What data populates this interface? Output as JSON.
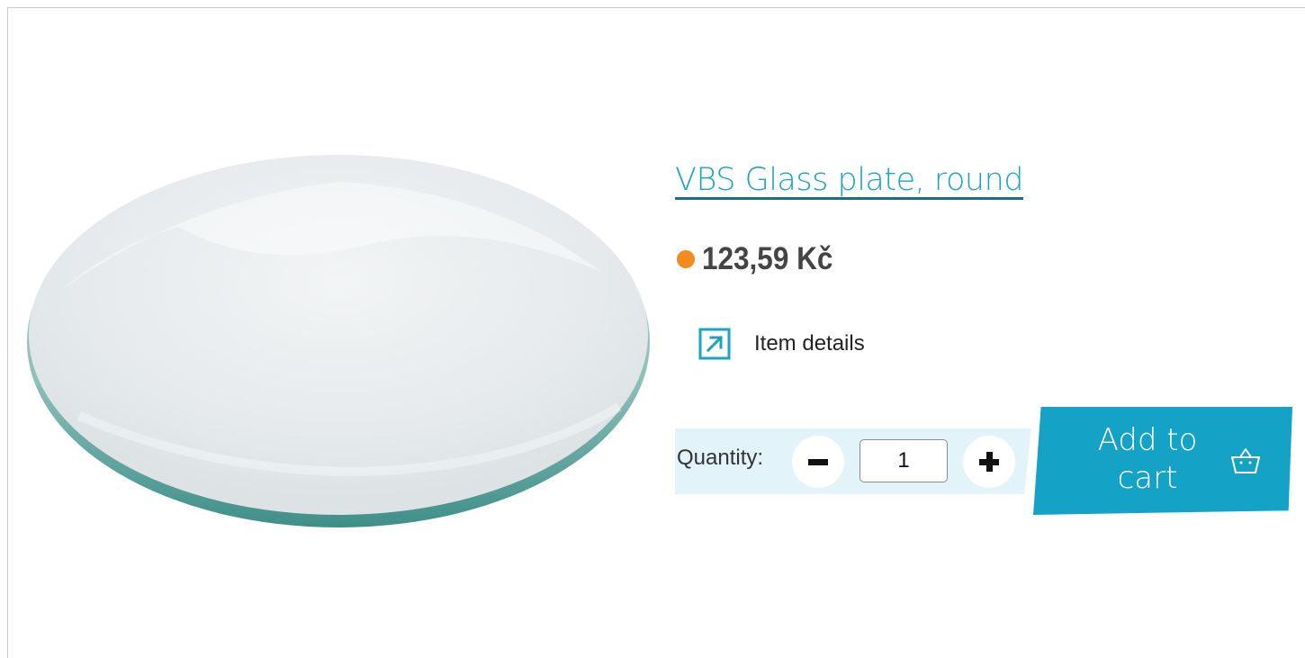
{
  "product": {
    "title": "VBS Glass plate, round",
    "price": "123,59 Kč",
    "details_label": "Item details",
    "image_alt": "glass-plate-image"
  },
  "quantity": {
    "label": "Quantity:",
    "value": "1"
  },
  "cart": {
    "button_label": "Add to cart"
  },
  "colors": {
    "accent": "#14a2c6",
    "stock_dot": "#f28c1f",
    "quantity_panel": "#e2f4f9"
  },
  "icons": {
    "details": "external-link-icon",
    "cart": "basket-icon",
    "decrement": "minus-icon",
    "increment": "plus-icon"
  }
}
